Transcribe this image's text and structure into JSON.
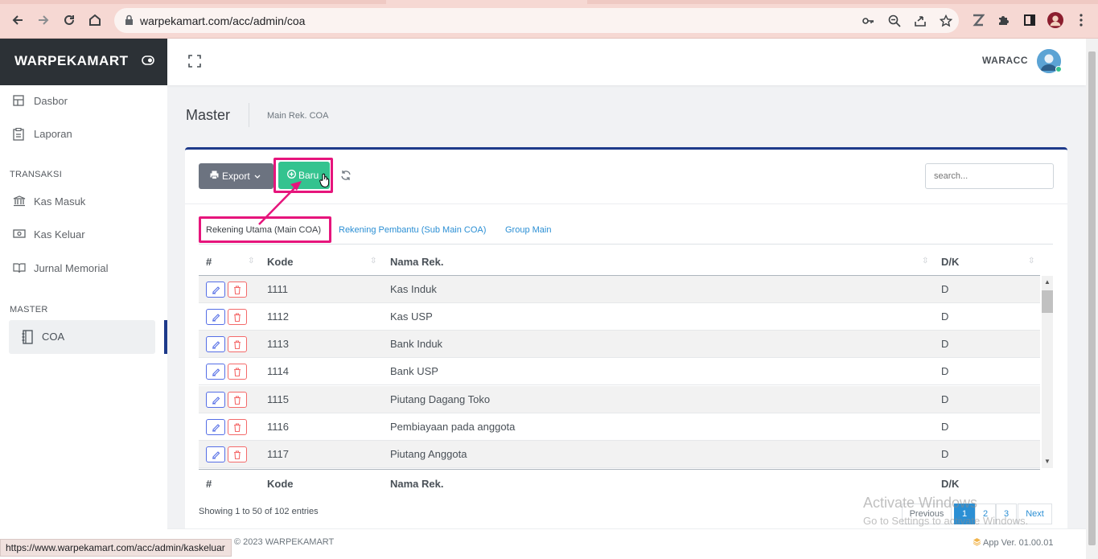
{
  "browser": {
    "url": "warpekamart.com/acc/admin/coa",
    "status_url": "https://www.warpekamart.com/acc/admin/kaskeluar"
  },
  "brand": {
    "name": "WARPEKAMART"
  },
  "header": {
    "user": "WARACC"
  },
  "sidebar": {
    "items": [
      {
        "label": "Dasbor",
        "icon": "dashboard-icon"
      },
      {
        "label": "Laporan",
        "icon": "report-icon"
      }
    ],
    "section_transaksi": "TRANSAKSI",
    "transaksi_items": [
      {
        "label": "Kas Masuk",
        "icon": "bank-icon"
      },
      {
        "label": "Kas Keluar",
        "icon": "cash-icon"
      },
      {
        "label": "Jurnal Memorial",
        "icon": "book-icon"
      }
    ],
    "section_master": "MASTER",
    "master_items": [
      {
        "label": "COA",
        "icon": "notebook-icon",
        "active": true
      }
    ]
  },
  "page": {
    "title": "Master",
    "breadcrumb": "Main Rek. COA"
  },
  "toolbar": {
    "export_label": "Export",
    "new_label": "Baru",
    "search_placeholder": "search..."
  },
  "tabs": [
    {
      "label": "Rekening Utama (Main COA)",
      "active": true
    },
    {
      "label": "Rekening Pembantu (Sub Main COA)",
      "active": false
    },
    {
      "label": "Group Main",
      "active": false
    }
  ],
  "table": {
    "columns": [
      "#",
      "Kode",
      "Nama Rek.",
      "D/K"
    ],
    "rows": [
      {
        "kode": "1111",
        "nama": "Kas Induk",
        "dk": "D"
      },
      {
        "kode": "1112",
        "nama": "Kas USP",
        "dk": "D"
      },
      {
        "kode": "1113",
        "nama": "Bank Induk",
        "dk": "D"
      },
      {
        "kode": "1114",
        "nama": "Bank USP",
        "dk": "D"
      },
      {
        "kode": "1115",
        "nama": "Piutang Dagang Toko",
        "dk": "D"
      },
      {
        "kode": "1116",
        "nama": "Pembiayaan pada anggota",
        "dk": "D"
      },
      {
        "kode": "1117",
        "nama": "Piutang Anggota",
        "dk": "D"
      }
    ],
    "info": "Showing 1 to 50 of 102 entries"
  },
  "pagination": {
    "previous": "Previous",
    "pages": [
      "1",
      "2",
      "3"
    ],
    "current": "1",
    "next": "Next"
  },
  "watermark": {
    "line1": "Activate Windows",
    "line2": "Go to Settings to activate Windows."
  },
  "footer": {
    "copyright": "© 2023 WARPEKAMART",
    "version": "App Ver. 01.00.01"
  },
  "colors": {
    "brand_dark": "#2c3136",
    "accent_blue": "#1e3a8a",
    "success": "#34c38f",
    "highlight": "#e6157c",
    "link": "#2b8fd4"
  }
}
